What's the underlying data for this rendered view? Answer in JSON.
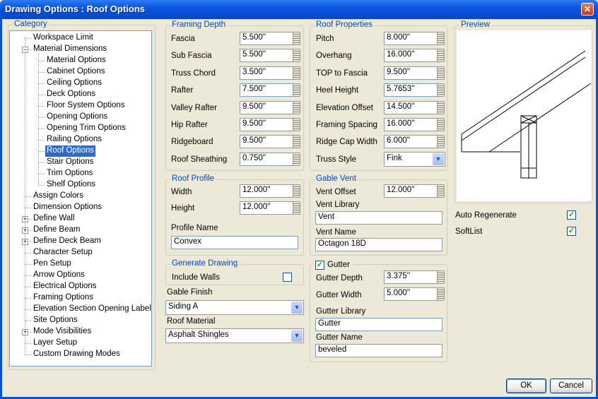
{
  "title": "Drawing Options : Roof Options",
  "category": {
    "label": "Category",
    "items": [
      {
        "label": "Workspace Limit"
      },
      {
        "label": "Material Dimensions",
        "expander": "−"
      },
      {
        "label": "Material Options"
      },
      {
        "label": "Cabinet Options"
      },
      {
        "label": "Ceiling Options"
      },
      {
        "label": "Deck Options"
      },
      {
        "label": "Floor System Options"
      },
      {
        "label": "Opening Options"
      },
      {
        "label": "Opening Trim Options"
      },
      {
        "label": "Railing Options"
      },
      {
        "label": "Roof Options"
      },
      {
        "label": "Stair Options"
      },
      {
        "label": "Trim Options"
      },
      {
        "label": "Shelf Options"
      },
      {
        "label": "Assign Colors"
      },
      {
        "label": "Dimension Options"
      },
      {
        "label": "Define Wall",
        "expander": "+"
      },
      {
        "label": "Define Beam",
        "expander": "+"
      },
      {
        "label": "Define Deck Beam",
        "expander": "+"
      },
      {
        "label": "Character Setup"
      },
      {
        "label": "Pen Setup"
      },
      {
        "label": "Arrow Options"
      },
      {
        "label": "Electrical Options"
      },
      {
        "label": "Framing Options"
      },
      {
        "label": "Elevation Section Opening Labels"
      },
      {
        "label": "Site Options"
      },
      {
        "label": "Mode Visibilities",
        "expander": "+"
      },
      {
        "label": "Layer Setup"
      },
      {
        "label": "Custom Drawing Modes"
      }
    ]
  },
  "framing_depth": {
    "label": "Framing Depth",
    "fields": [
      {
        "label": "Fascia",
        "value": "5.500''"
      },
      {
        "label": "Sub Fascia",
        "value": "5.500''"
      },
      {
        "label": "Truss Chord",
        "value": "3.500''"
      },
      {
        "label": "Rafter",
        "value": "7.500''"
      },
      {
        "label": "Valley Rafter",
        "value": "9.500''"
      },
      {
        "label": "Hip Rafter",
        "value": "9.500''"
      },
      {
        "label": "Ridgeboard",
        "value": "9.500''"
      },
      {
        "label": "Roof Sheathing",
        "value": "0.750''"
      }
    ]
  },
  "roof_properties": {
    "label": "Roof Properties",
    "fields": [
      {
        "label": "Pitch",
        "value": "8.000''"
      },
      {
        "label": "Overhang",
        "value": "16.000''"
      },
      {
        "label": "TOP to Fascia",
        "value": "9.500''"
      },
      {
        "label": "Heel Height",
        "value": "5.7653''"
      },
      {
        "label": "Elevation Offset",
        "value": "14.500''"
      },
      {
        "label": "Framing Spacing",
        "value": "16.000''"
      },
      {
        "label": "Ridge Cap Width",
        "value": "6.000''"
      }
    ],
    "truss_style_label": "Truss Style",
    "truss_style": "Fink"
  },
  "roof_profile": {
    "label": "Roof Profile",
    "width_label": "Width",
    "width": "12.000''",
    "height_label": "Height",
    "height": "12.000''",
    "profile_name_label": "Profile Name",
    "profile_name": "Convex"
  },
  "gable_vent": {
    "label": "Gable Vent",
    "vent_offset_label": "Vent Offset",
    "vent_offset": "12.000''",
    "vent_library_label": "Vent Library",
    "vent_library": "Vent",
    "vent_name_label": "Vent Name",
    "vent_name": "Octagon 18D"
  },
  "generate_drawing": {
    "label": "Generate Drawing",
    "include_walls_label": "Include Walls",
    "include_walls": false
  },
  "gable_finish": {
    "label": "Gable Finish",
    "value": "Siding A"
  },
  "roof_material": {
    "label": "Roof Material",
    "value": "Asphalt Shingles"
  },
  "gutter": {
    "label": "Gutter",
    "checked": true,
    "depth_label": "Gutter Depth",
    "depth": "3.375''",
    "width_label": "Gutter Width",
    "width": "5.000''",
    "library_label": "Gutter Library",
    "library": "Gutter",
    "name_label": "Gutter Name",
    "name": "beveled"
  },
  "preview": {
    "label": "Preview"
  },
  "auto_regenerate": {
    "label": "Auto Regenerate",
    "checked": true
  },
  "softlist": {
    "label": "SoftList",
    "checked": true
  },
  "buttons": {
    "ok": "OK",
    "cancel": "Cancel",
    "close": "✕"
  },
  "icons": {
    "close": "close-icon",
    "spin": "spinner-icon",
    "dropdown": "chevron-down-icon",
    "check": "checkmark-icon"
  }
}
